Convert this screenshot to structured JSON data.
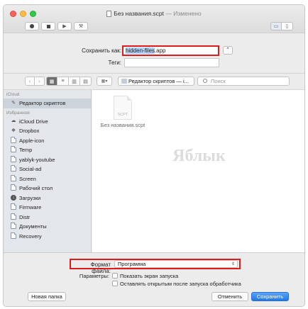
{
  "window": {
    "title": "Без названия.scpt",
    "title_sep": "—",
    "edited": "Изменено"
  },
  "save_sheet": {
    "save_as_label": "Сохранить как:",
    "filename_selected": "hidden-files",
    "filename_ext": ".app",
    "tags_label": "Теги:",
    "tags_value": ""
  },
  "browser": {
    "location": "Редактор скриптов — i...",
    "search_placeholder": "Поиск"
  },
  "sidebar": {
    "sections": [
      {
        "header": "iCloud",
        "items": [
          {
            "label": "Редактор скриптов",
            "icon": "script-editor-icon",
            "selected": true
          }
        ]
      },
      {
        "header": "Избранное",
        "items": [
          {
            "label": "iCloud Drive",
            "icon": "cloud-icon"
          },
          {
            "label": "Dropbox",
            "icon": "dropbox-icon"
          },
          {
            "label": "Apple-icon",
            "icon": "folder-icon"
          },
          {
            "label": "Temp",
            "icon": "folder-icon"
          },
          {
            "label": "yablyk-youtube",
            "icon": "folder-icon"
          },
          {
            "label": "Social-ad",
            "icon": "folder-icon"
          },
          {
            "label": "Screen",
            "icon": "folder-icon"
          },
          {
            "label": "Рабочий стол",
            "icon": "folder-icon"
          },
          {
            "label": "Загрузки",
            "icon": "downloads-icon"
          },
          {
            "label": "Firmware",
            "icon": "folder-icon"
          },
          {
            "label": "Distr",
            "icon": "folder-icon"
          },
          {
            "label": "Документы",
            "icon": "folder-icon"
          },
          {
            "label": "Recovery",
            "icon": "folder-icon"
          }
        ]
      }
    ]
  },
  "files": [
    {
      "name": "Без названия.scpt",
      "icon_label": "SCPT"
    }
  ],
  "watermark": "Яблык",
  "bottom": {
    "format_label": "Формат файла:",
    "format_value": "Программа",
    "params_label": "Параметры:",
    "opt1": "Показать экран запуска",
    "opt2": "Оставлять открытым после запуска обработчика",
    "new_folder": "Новая папка",
    "cancel": "Отменить",
    "save": "Сохранить"
  }
}
